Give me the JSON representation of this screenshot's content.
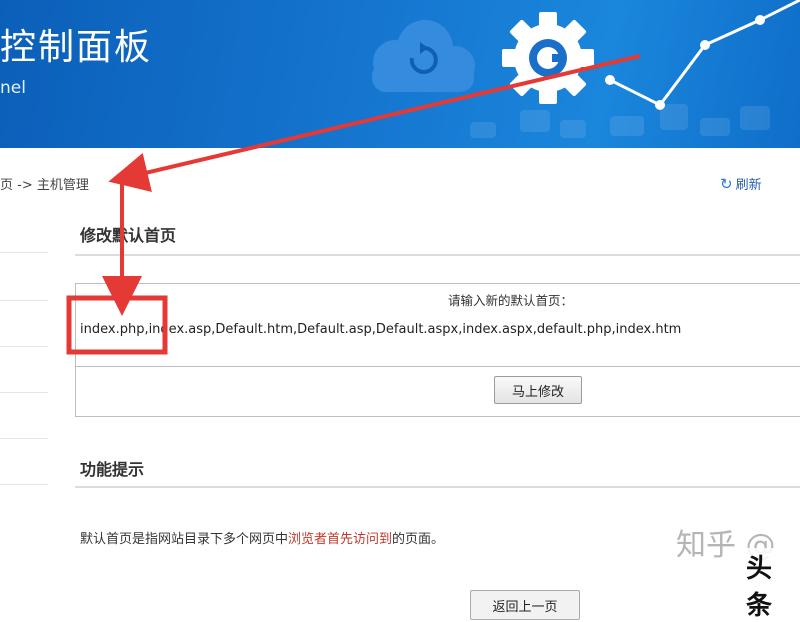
{
  "header": {
    "title": "控制面板",
    "subtitle": "nel"
  },
  "breadcrumb": {
    "prefix": "页 -> ",
    "current": "主机管理"
  },
  "toolbar": {
    "refresh_label": "刷新"
  },
  "sections": {
    "modify": {
      "title": "修改默认首页",
      "prompt": "请输入新的默认首页：",
      "value": "index.php,index.asp,Default.htm,Default.asp,Default.aspx,index.aspx,default.php,index.htm",
      "submit_label": "马上修改"
    },
    "tips": {
      "title": "功能提示",
      "text_before": "默认首页是指网站目录下多个网页中",
      "text_highlight": "浏览者首先访问到",
      "text_after": "的页面。"
    }
  },
  "footer": {
    "button_label": "返回上一页"
  },
  "watermark": {
    "zhihu": "知乎 @",
    "toutiao": "头条"
  },
  "colors": {
    "banner": "#1575cf",
    "annotation": "#e53935",
    "highlight_text": "#c0392b"
  }
}
